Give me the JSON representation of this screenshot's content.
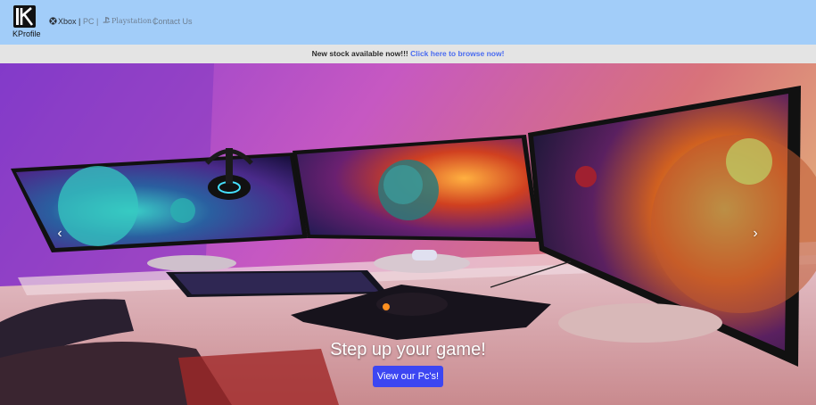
{
  "brand": {
    "name": "KProfile",
    "logo_letter": "K"
  },
  "nav": {
    "xbox": "Xbox |",
    "pc": "PC |",
    "playstation": "Playstation |",
    "contact": "Contact Us"
  },
  "banner": {
    "text": "New stock available now!!! ",
    "link": "Click here to browse now!"
  },
  "hero": {
    "title": "Step up your game!",
    "button": "View our Pc's!",
    "prev_icon": "‹",
    "next_icon": "›"
  },
  "colors": {
    "navbar": "#a2cdf9",
    "banner": "#e4e4e4",
    "link": "#4a6cf0",
    "button": "#3c46f2"
  },
  "icons": [
    "xbox-icon",
    "playstation-icon",
    "chevron-left-icon",
    "chevron-right-icon"
  ]
}
